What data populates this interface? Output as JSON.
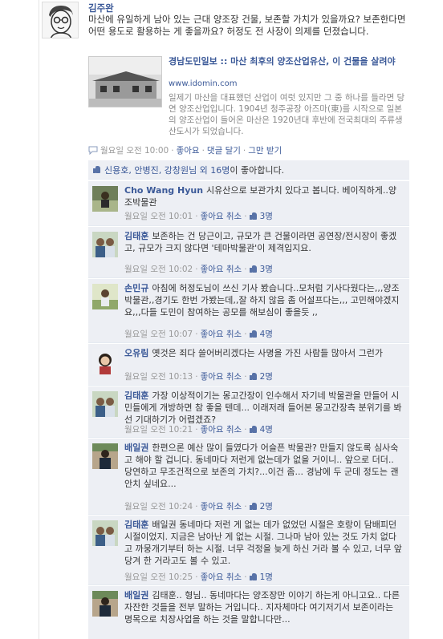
{
  "post": {
    "author": "김주완",
    "body": "마산에 유일하게 남아 있는 근대 양조장 건물, 보존할 가치가 있을까요? 보존한다면 어떤 용도로 활용하는 게 좋을까요? 허정도 전 사장이 의제를 던졌습니다.",
    "attachment": {
      "title": "경남도민일보 :: 마산 최후의 양조산업유산, 이 건물을 살려야",
      "url": "www.idomin.com",
      "description": "일제기 마산을 대표했던 산업이 여럿 있지만 그 중 하나를 들라면 당연 양조산업입니다. 1904년 청주공장 아즈마(東)를 시작으로 일본의 양조산업이 들어온 마산은 1920년대 후반에 전국최대의 주류생산도시가 되었습니다."
    },
    "timestamp": "월요일 오전 10:00",
    "actions": [
      "좋아요",
      "댓글 달기",
      "그만 받기"
    ]
  },
  "likes": {
    "names": "신용호, 안병진, 강창원님 외 16명",
    "suffix": "이 좋아합니다."
  },
  "comments": [
    {
      "author": "Cho Wang Hyun",
      "text": "시유산으로 보관가치 있다고 봅니다. 베이직하게..양조박물관",
      "time": "월요일 오전 10:01",
      "unlike": "좋아요 취소",
      "likes": "3명"
    },
    {
      "author": "김태훈",
      "text": "보존하는 건 당근이고, 규모가 큰 건물이라면 공연장/전시장이 좋겠고, 규모가 크지 않다면 '테마박물관'이 제격입지요.",
      "time": "월요일 오전 10:02",
      "unlike": "좋아요 취소",
      "likes": "3명"
    },
    {
      "author": "손민규",
      "text": "아침에 허정도님이 쓰신 기사 봤습니다..모처럼 기사다웠다는,,,양조 박물관,,경기도 한번 가봤는데,,잘 하지 않음 좀 어설프다는,,, 고민해야겠지요,,,다들 도민이 참여하는 공모를 해보심이 좋을듯 ,,",
      "time": "월요일 오전 10:07",
      "unlike": "좋아요 취소",
      "likes": "4명"
    },
    {
      "author": "오유림",
      "text": "옛것은 죄다 쓸어버리겠다는 사명을 가진 사람들 많아서 그런가",
      "time": "월요일 오전 10:13",
      "unlike": "좋아요 취소",
      "likes": "2명"
    },
    {
      "author": "김태훈",
      "text": "가장 이상적이기는 몽고간장이 인수해서 자기네 박물관을 만들어 시민들에게 개방하면 참 좋을 텐데... 이래저래 들어본 몽고간장측 분위기를 봐선 기대하기가 어렵겠죠?",
      "time": "월요일 오전 10:21",
      "unlike": "좋아요 취소",
      "likes": "4명"
    },
    {
      "author": "배일권",
      "text": "한편으론 예산 많이 들였다가 어슬픈 박물관? 만들지 않도록 심사숙고 해야 할 겁니다. 동네마다 저런게 없는데가 없을 거이니.. 앞으로 더더.. 당연하고 무조건적으로 보존의 가치?...이건 좀... 경남에 두 군데 정도는 괜안치 싶네요...",
      "time": "월요일 오전 10:24",
      "unlike": "좋아요 취소",
      "likes": "2명"
    },
    {
      "author": "김태훈",
      "text": "배일권 동네마다 저런 게 없는 데가 없었던 시절은 호랑이 담배피던 시절이었지. 지금은 남아난 게 없는 시절. 그나마 남아 있는 것도 가치 없다고 까뭉개기부터 하는 시절. 너무 걱정을 늦게 하신 거라 볼 수 있고, 너무 앞당겨 한 거라고도 볼 수 있고.",
      "time": "월요일 오전 10:25",
      "unlike": "좋아요 취소",
      "likes": "1명"
    },
    {
      "author": "배일권",
      "text": "김태훈.. 형님.. 동네마다는 양조장만 이야기 하는게 아니고요.. 다른 자잔한 것들을 전부 말하는 거입니다.. 지자체마다 여기저기서 보존이라는 명목으로 치장사업을 하는 것을 말합니다만...",
      "time": "",
      "unlike": "",
      "likes": ""
    }
  ],
  "icons": {
    "like": "thumbs-up-icon",
    "comment": "comment-icon"
  },
  "colors": {
    "link": "#3b5998",
    "comment_bg": "#edeff4"
  }
}
